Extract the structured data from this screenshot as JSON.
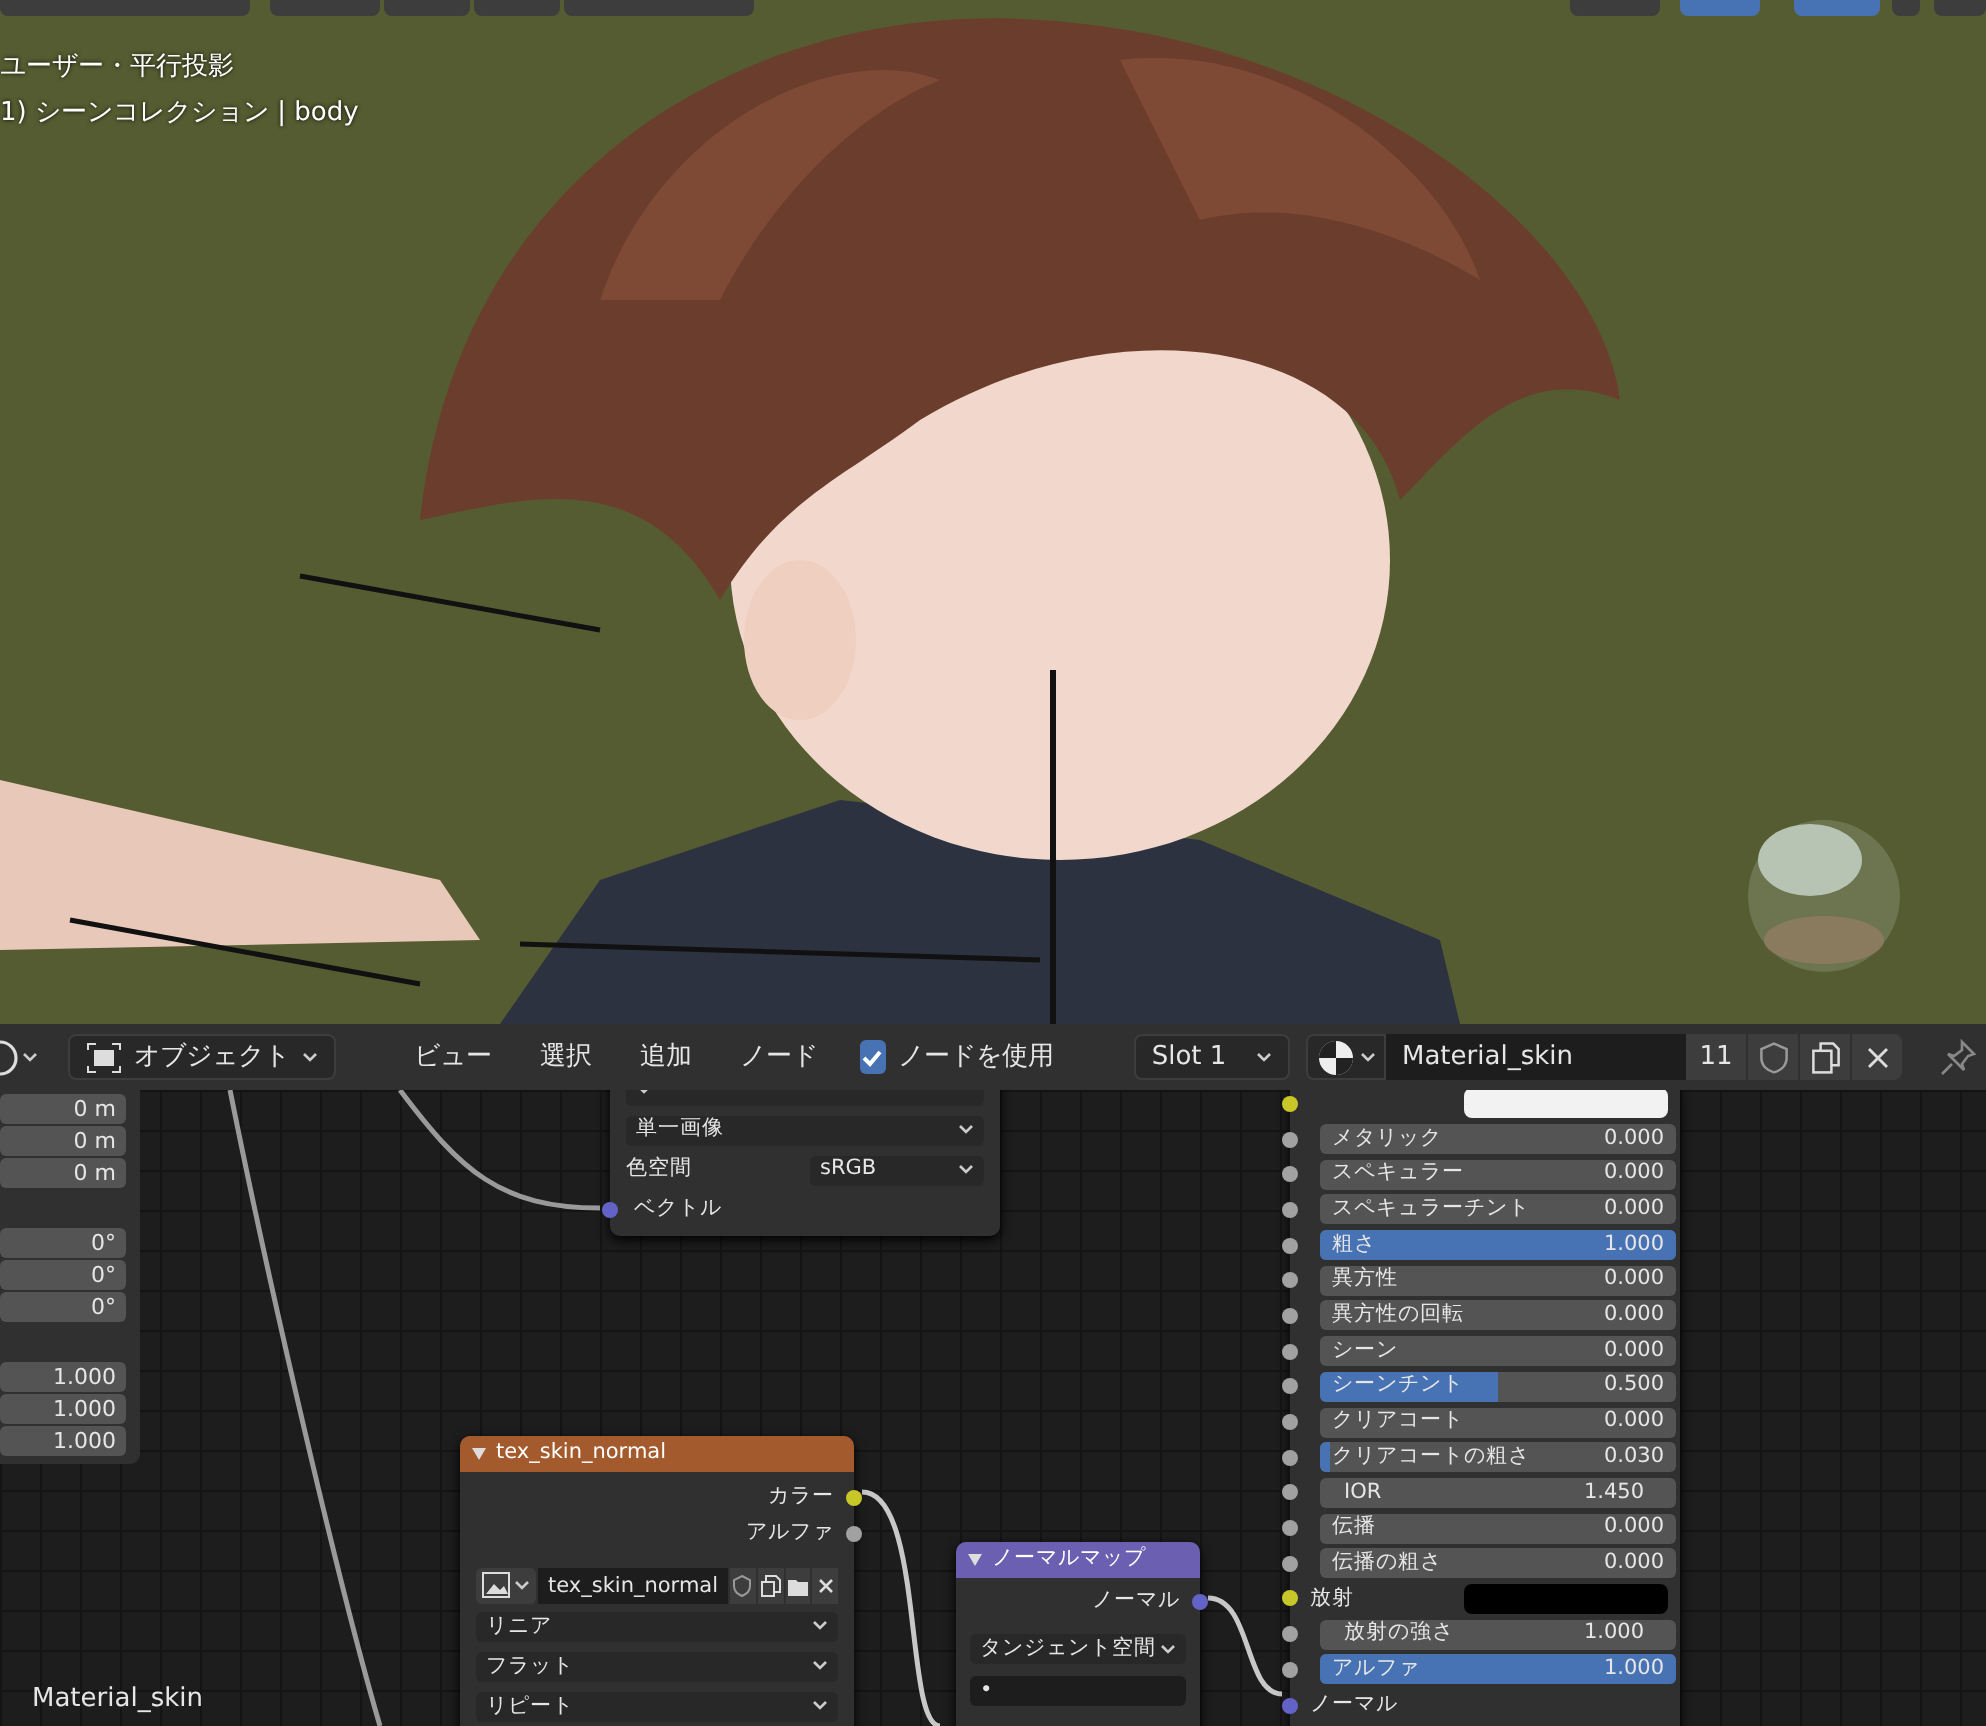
{
  "viewport": {
    "overlay_lines": [
      "ユーザー・平行投影",
      "1) シーンコレクション | body"
    ],
    "header_buttons": [
      {
        "selected": false
      },
      {
        "selected": false
      },
      {
        "selected": false
      },
      {
        "selected": false
      },
      {
        "selected": false
      },
      {
        "selected": false
      },
      {
        "selected": true
      },
      {
        "selected": true
      },
      {
        "selected": false
      },
      {
        "selected": false
      }
    ]
  },
  "node_header": {
    "mode": "オブジェクト",
    "menus": [
      "ビュー",
      "選択",
      "追加",
      "ノード"
    ],
    "use_nodes": {
      "label": "ノードを使用",
      "checked": true
    },
    "slot": "Slot 1",
    "material": "Material_skin",
    "users": "11"
  },
  "side_panel": {
    "fields": [
      "0 m",
      "0 m",
      "0 m",
      "0°",
      "0°",
      "0°",
      "1.000",
      "1.000",
      "1.000"
    ]
  },
  "image_node": {
    "rows": [
      {
        "kind": "dropdown"
      },
      {
        "kind": "dropdown",
        "text": "単一画像"
      },
      {
        "kind": "labeled",
        "label": "色空間",
        "text": "sRGB"
      },
      {
        "kind": "input",
        "label": "ベクトル",
        "color": "#6363c7"
      }
    ]
  },
  "principled_node": {
    "rows": [
      {
        "kind": "swatch",
        "swatch": {
          "color": "#f2f2f2"
        },
        "color": "#c7c729"
      },
      {
        "kind": "slider",
        "label": "メタリック",
        "value": "0.000",
        "level": 0,
        "color": "#a1a1a1"
      },
      {
        "kind": "slider",
        "label": "スペキュラー",
        "value": "0.000",
        "level": 0,
        "color": "#a1a1a1"
      },
      {
        "kind": "slider",
        "label": "スペキュラーチント",
        "value": "0.000",
        "level": 0,
        "color": "#a1a1a1"
      },
      {
        "kind": "slider",
        "label": "粗さ",
        "value": "1.000",
        "level": 1,
        "color": "#a1a1a1"
      },
      {
        "kind": "slider",
        "label": "異方性",
        "value": "0.000",
        "level": 0,
        "color": "#a1a1a1"
      },
      {
        "kind": "slider",
        "label": "異方性の回転",
        "value": "0.000",
        "level": 0,
        "color": "#a1a1a1"
      },
      {
        "kind": "slider",
        "label": "シーン",
        "value": "0.000",
        "level": 0,
        "color": "#a1a1a1"
      },
      {
        "kind": "slider",
        "label": "シーンチント",
        "value": "0.500",
        "level": 0.5,
        "color": "#a1a1a1"
      },
      {
        "kind": "slider",
        "label": "クリアコート",
        "value": "0.000",
        "level": 0,
        "color": "#a1a1a1"
      },
      {
        "kind": "slider",
        "label": "クリアコートの粗さ",
        "value": "0.030",
        "level": 0.03,
        "color": "#a1a1a1"
      },
      {
        "kind": "number",
        "label": "IOR",
        "value": "1.450",
        "color": "#a1a1a1"
      },
      {
        "kind": "slider",
        "label": "伝播",
        "value": "0.000",
        "level": 0,
        "color": "#a1a1a1"
      },
      {
        "kind": "slider",
        "label": "伝播の粗さ",
        "value": "0.000",
        "level": 0,
        "color": "#a1a1a1"
      },
      {
        "kind": "swatch",
        "label": "放射",
        "swatch": {
          "color": "#000000"
        },
        "color": "#c7c729"
      },
      {
        "kind": "number",
        "label": "放射の強さ",
        "value": "1.000",
        "color": "#a1a1a1"
      },
      {
        "kind": "slider",
        "label": "アルファ",
        "value": "1.000",
        "level": 1,
        "color": "#a1a1a1"
      },
      {
        "kind": "input",
        "label": "ノーマル",
        "color": "#6363c7"
      }
    ]
  },
  "texture_node": {
    "title": "tex_skin_normal",
    "outputs": [
      {
        "label": "カラー",
        "color": "#c7c729"
      },
      {
        "label": "アルファ",
        "color": "#a1a1a1"
      }
    ],
    "image": "tex_skin_normal",
    "dropdowns": [
      "リニア",
      "フラット",
      "リピート"
    ]
  },
  "normal_map_node": {
    "title": "ノーマルマップ",
    "outputs": [
      {
        "label": "ノーマル",
        "color": "#6363c7"
      }
    ],
    "space": "タンジェント空間",
    "uv": "•"
  },
  "material_label": "Material_skin"
}
